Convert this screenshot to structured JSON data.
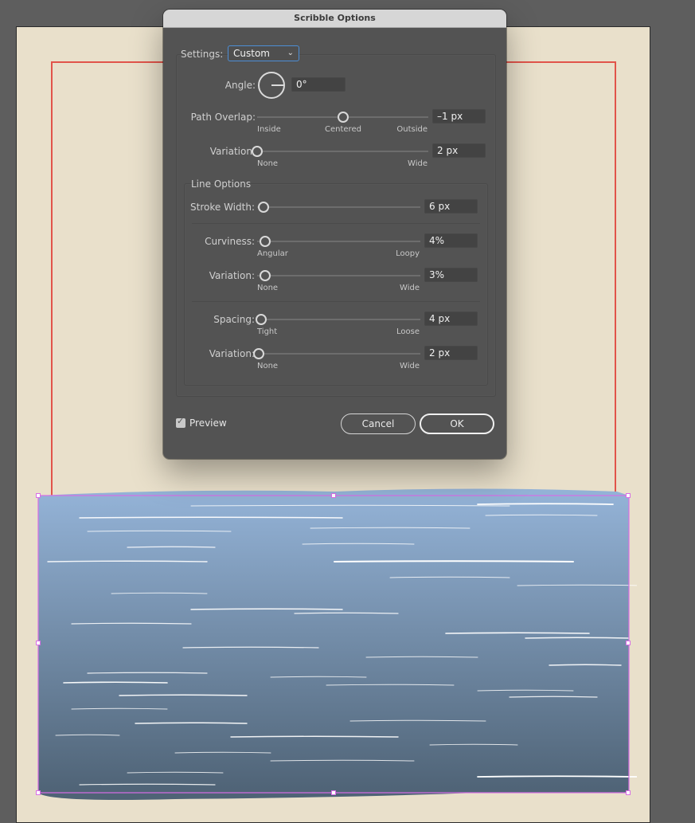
{
  "dialog": {
    "title": "Scribble Options",
    "settings": {
      "label": "Settings:",
      "value": "Custom"
    },
    "angle": {
      "label": "Angle:",
      "value": "0°",
      "dial_degrees": 0
    },
    "path_overlap": {
      "label": "Path Overlap:",
      "value": "–1 px",
      "slider_position": 0.5,
      "ticks": [
        "Inside",
        "Centered",
        "Outside"
      ]
    },
    "overlap_variation": {
      "label": "Variation:",
      "value": "2 px",
      "slider_position": 0.0,
      "ticks": [
        "None",
        "Wide"
      ]
    },
    "line_options": {
      "title": "Line Options",
      "stroke_width": {
        "label": "Stroke Width:",
        "value": "6 px",
        "slider_position": 0.02
      },
      "curviness": {
        "label": "Curviness:",
        "value": "4%",
        "slider_position": 0.04,
        "ticks": [
          "Angular",
          "Loopy"
        ]
      },
      "curviness_variation": {
        "label": "Variation:",
        "value": "3%",
        "slider_position": 0.03,
        "ticks": [
          "None",
          "Wide"
        ]
      },
      "spacing": {
        "label": "Spacing:",
        "value": "4 px",
        "slider_position": 0.01,
        "ticks": [
          "Tight",
          "Loose"
        ]
      },
      "spacing_variation": {
        "label": "Variation:",
        "value": "2 px",
        "slider_position": 0.0,
        "ticks": [
          "None",
          "Wide"
        ]
      }
    },
    "preview": {
      "label": "Preview",
      "checked": true
    },
    "buttons": {
      "cancel": "Cancel",
      "ok": "OK"
    }
  },
  "canvas": {
    "artboard_color": "#e9e0cb",
    "bleed_guide_color": "#e1544a",
    "selection_color": "#d86de6",
    "scribble_gradient": [
      "#92b1d5",
      "#4f6377"
    ]
  }
}
